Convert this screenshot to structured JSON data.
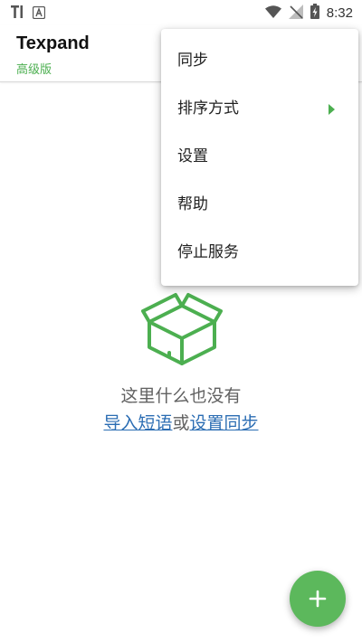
{
  "status_bar": {
    "time": "8:32",
    "left_icons": [
      "t-notification-icon",
      "a-notification-icon"
    ],
    "right_icons": [
      "wifi-icon",
      "no-signal-icon",
      "battery-charging-icon"
    ]
  },
  "app_bar": {
    "title": "Texpand",
    "subtitle": "高级版"
  },
  "menu": {
    "items": [
      {
        "label": "同步"
      },
      {
        "label": "排序方式",
        "has_submenu": true
      },
      {
        "label": "设置"
      },
      {
        "label": "帮助"
      },
      {
        "label": "停止服务"
      }
    ]
  },
  "empty_state": {
    "icon": "open-box-icon",
    "message": "这里什么也没有",
    "import_link": "导入短语",
    "or_text": "或",
    "sync_link": "设置同步"
  },
  "fab": {
    "icon": "plus-icon"
  },
  "colors": {
    "accent": "#4caf50",
    "fab": "#5cb85c",
    "link": "#2b6db3"
  }
}
